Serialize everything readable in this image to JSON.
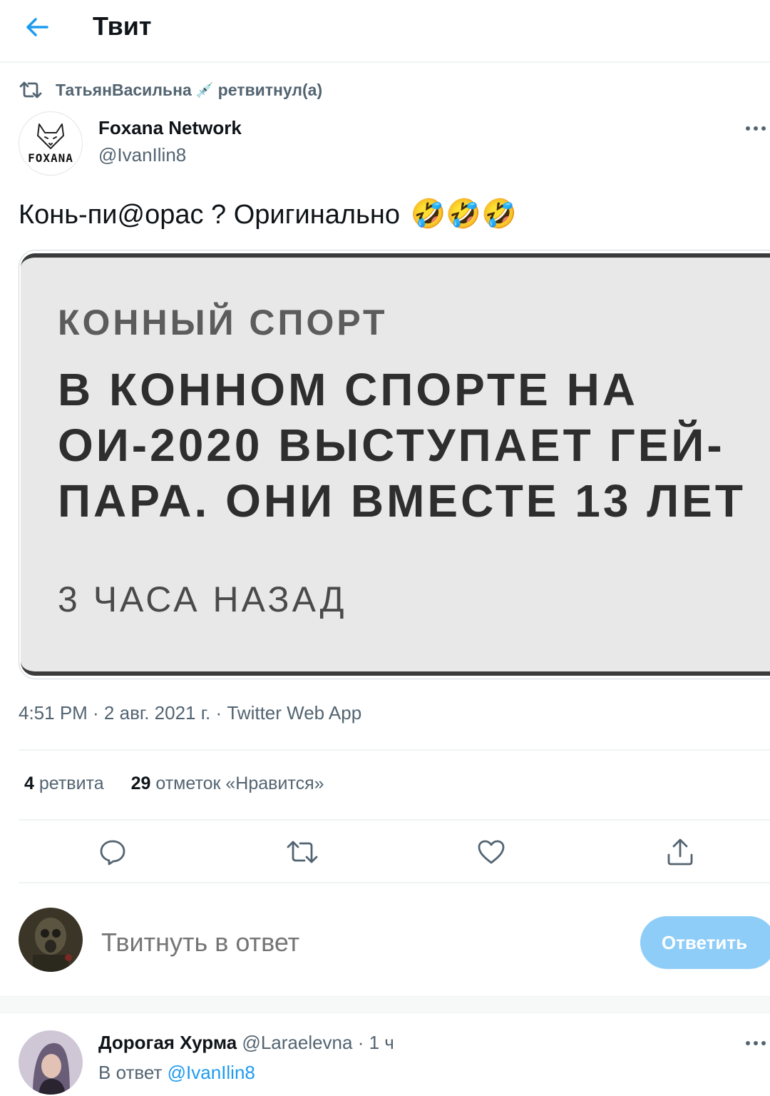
{
  "header": {
    "title": "Твит"
  },
  "retweet": {
    "user": "ТатьянВасильна",
    "emoji": "💉",
    "suffix": "ретвитнул(а)"
  },
  "tweet": {
    "author_name": "Foxana Network",
    "handle": "@IvanIlin8",
    "avatar_logo": "FOXANA",
    "text": "Конь-пи@орас ? Оригинально",
    "emojis": "🤣🤣🤣",
    "media": {
      "category": "КОННЫЙ СПОРТ",
      "headline": "В КОННОМ СПОРТЕ НА ОИ-2020 ВЫСТУПАЕТ ГЕЙ-ПАРА. ОНИ ВМЕСТЕ 13 ЛЕТ",
      "time": "3 ЧАСА НАЗАД"
    },
    "meta": "4:51 PM · 2 авг. 2021 г. · Twitter Web App",
    "retweets_count": "4",
    "retweets_label": "ретвита",
    "likes_count": "29",
    "likes_label": "отметок «Нравится»"
  },
  "actions": [
    {
      "name": "reply",
      "icon": "reply-icon"
    },
    {
      "name": "retweet",
      "icon": "retweet-icon"
    },
    {
      "name": "like",
      "icon": "heart-icon"
    },
    {
      "name": "share",
      "icon": "share-icon"
    }
  ],
  "compose": {
    "placeholder": "Твитнуть в ответ",
    "button": "Ответить",
    "button_color": "#8ecdf8"
  },
  "reply": {
    "name": "Дорогая Хурма",
    "handle": "@Laraelevna",
    "time": "· 1 ч",
    "reply_to_prefix": "В ответ",
    "reply_to_handle": "@IvanIlin8"
  },
  "colors": {
    "accent": "#1d9bf0",
    "secondary_text": "#536471",
    "text": "#0f1419"
  }
}
